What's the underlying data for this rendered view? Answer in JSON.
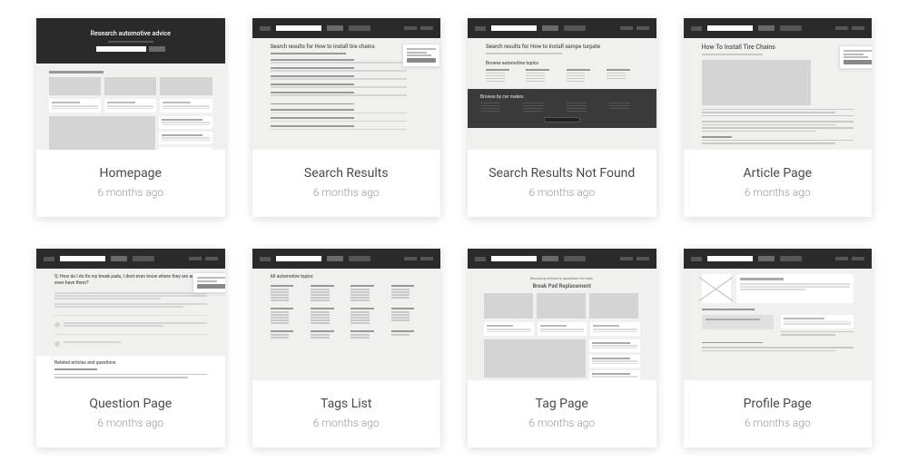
{
  "cards": [
    {
      "title": "Homepage",
      "time": "6 months ago",
      "hero": "Research automotive advice"
    },
    {
      "title": "Search Results",
      "time": "6 months ago",
      "query": "Search results for How to install tire chains"
    },
    {
      "title": "Search Results Not Found",
      "time": "6 months ago",
      "query": "Search results for How to install sampe turpate",
      "browse": "Browse automotive topics",
      "makes": "Browse by car makes"
    },
    {
      "title": "Article Page",
      "time": "6 months ago",
      "article": "How To Install Tire Chains"
    },
    {
      "title": "Question Page",
      "time": "6 months ago",
      "question": "Q: How do I do fix my break pads, I dont even know where they are and do I even have them?",
      "related": "Related articles and questions"
    },
    {
      "title": "Tags List",
      "time": "6 months ago",
      "heading": "All automotive topics"
    },
    {
      "title": "Tag Page",
      "time": "6 months ago",
      "browsing": "Browsing articles & questions for topic",
      "tag": "Break Pad Replacement"
    },
    {
      "title": "Profile Page",
      "time": "6 months ago"
    }
  ]
}
